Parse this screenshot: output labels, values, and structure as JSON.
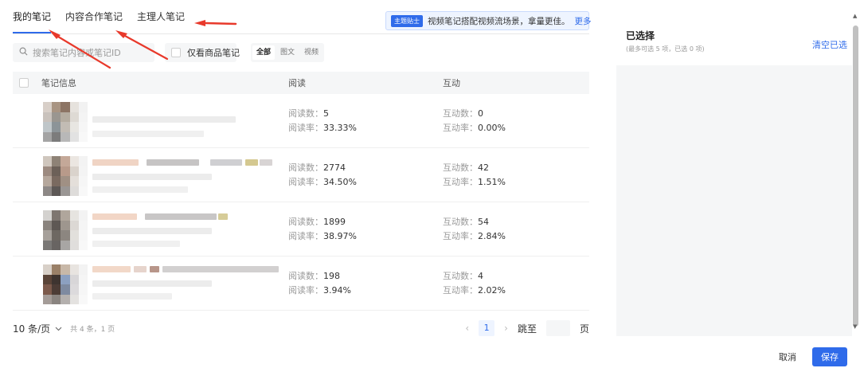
{
  "tabs": [
    {
      "label": "我的笔记",
      "active": true
    },
    {
      "label": "内容合作笔记",
      "active": false
    },
    {
      "label": "主理人笔记",
      "active": false
    }
  ],
  "tip": {
    "badge": "主题贴士",
    "text": "视频笔记搭配视频流场景，拿量更佳。",
    "more": "更多"
  },
  "filter": {
    "search_placeholder": "搜索笔记内容或笔记ID",
    "goods_only_label": "仅看商品笔记",
    "types": [
      {
        "label": "全部",
        "active": true
      },
      {
        "label": "图文",
        "active": false
      },
      {
        "label": "视频",
        "active": false
      }
    ]
  },
  "table": {
    "headers": {
      "info": "笔记信息",
      "read": "阅读",
      "interact": "互动"
    },
    "rows": [
      {
        "read_count_label": "阅读数：",
        "read_count": "5",
        "read_rate_label": "阅读率：",
        "read_rate": "33.33%",
        "interact_count_label": "互动数：",
        "interact_count": "0",
        "interact_rate_label": "互动率：",
        "interact_rate": "0.00%"
      },
      {
        "read_count_label": "阅读数：",
        "read_count": "2774",
        "read_rate_label": "阅读率：",
        "read_rate": "34.50%",
        "interact_count_label": "互动数：",
        "interact_count": "42",
        "interact_rate_label": "互动率：",
        "interact_rate": "1.51%"
      },
      {
        "read_count_label": "阅读数：",
        "read_count": "1899",
        "read_rate_label": "阅读率：",
        "read_rate": "38.97%",
        "interact_count_label": "互动数：",
        "interact_count": "54",
        "interact_rate_label": "互动率：",
        "interact_rate": "2.84%"
      },
      {
        "read_count_label": "阅读数：",
        "read_count": "198",
        "read_rate_label": "阅读率：",
        "read_rate": "3.94%",
        "interact_count_label": "互动数：",
        "interact_count": "4",
        "interact_rate_label": "互动率：",
        "interact_rate": "2.02%"
      }
    ]
  },
  "pager": {
    "page_size": "10 条/页",
    "total": "共 4 条，1 页",
    "current_page": "1",
    "jump_label": "跳至",
    "page_unit": "页"
  },
  "selected": {
    "title": "已选择",
    "subtitle": "(最多可选 5 项，已选 0 项)",
    "clear_label": "清空已选"
  },
  "footer": {
    "cancel_label": "取消",
    "save_label": "保存"
  },
  "colors": {
    "accent": "#2f6bea",
    "annotation_arrow": "#e8392b"
  }
}
